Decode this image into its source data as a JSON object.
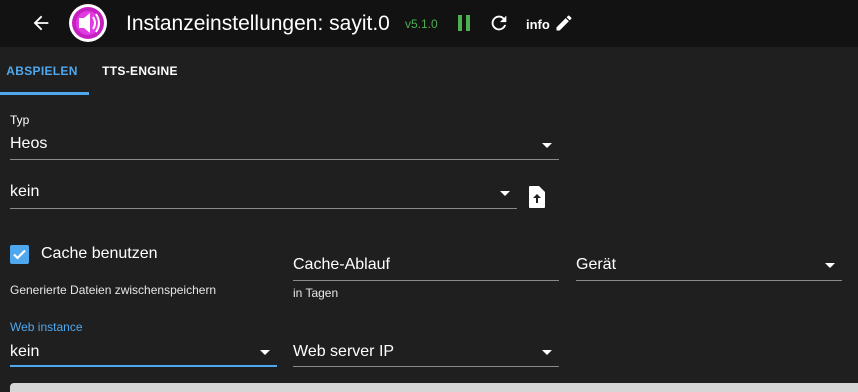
{
  "header": {
    "title": "Instanzeinstellungen: sayit.0",
    "version": "v5.1.0",
    "info_label": "info",
    "icons": {
      "back": "arrow-left-icon",
      "logo": "sayit-logo-icon",
      "pause": "pause-icon",
      "reload": "reload-icon",
      "edit": "pencil-icon"
    },
    "colors": {
      "version": "#4caf50",
      "pause": "#4caf50"
    }
  },
  "tabs": [
    {
      "label": "ABSPIELEN",
      "active": true
    },
    {
      "label": "TTS-ENGINE",
      "active": false
    }
  ],
  "form": {
    "type_label": "Typ",
    "type_value": "Heos",
    "device_value": "kein",
    "cache_label": "Cache benutzen",
    "cache_checked": true,
    "cache_helper": "Generierte Dateien zwischenspeichern",
    "cache_expiry_value": "Cache-Ablauf",
    "cache_expiry_helper": "in Tagen",
    "device_select_value": "Gerät",
    "web_instance_label": "Web instance",
    "web_instance_value": "kein",
    "web_server_ip_value": "Web server IP"
  },
  "colors": {
    "accent": "#4fa8ee",
    "background": "#1f1f1f",
    "header_background": "#121212"
  }
}
